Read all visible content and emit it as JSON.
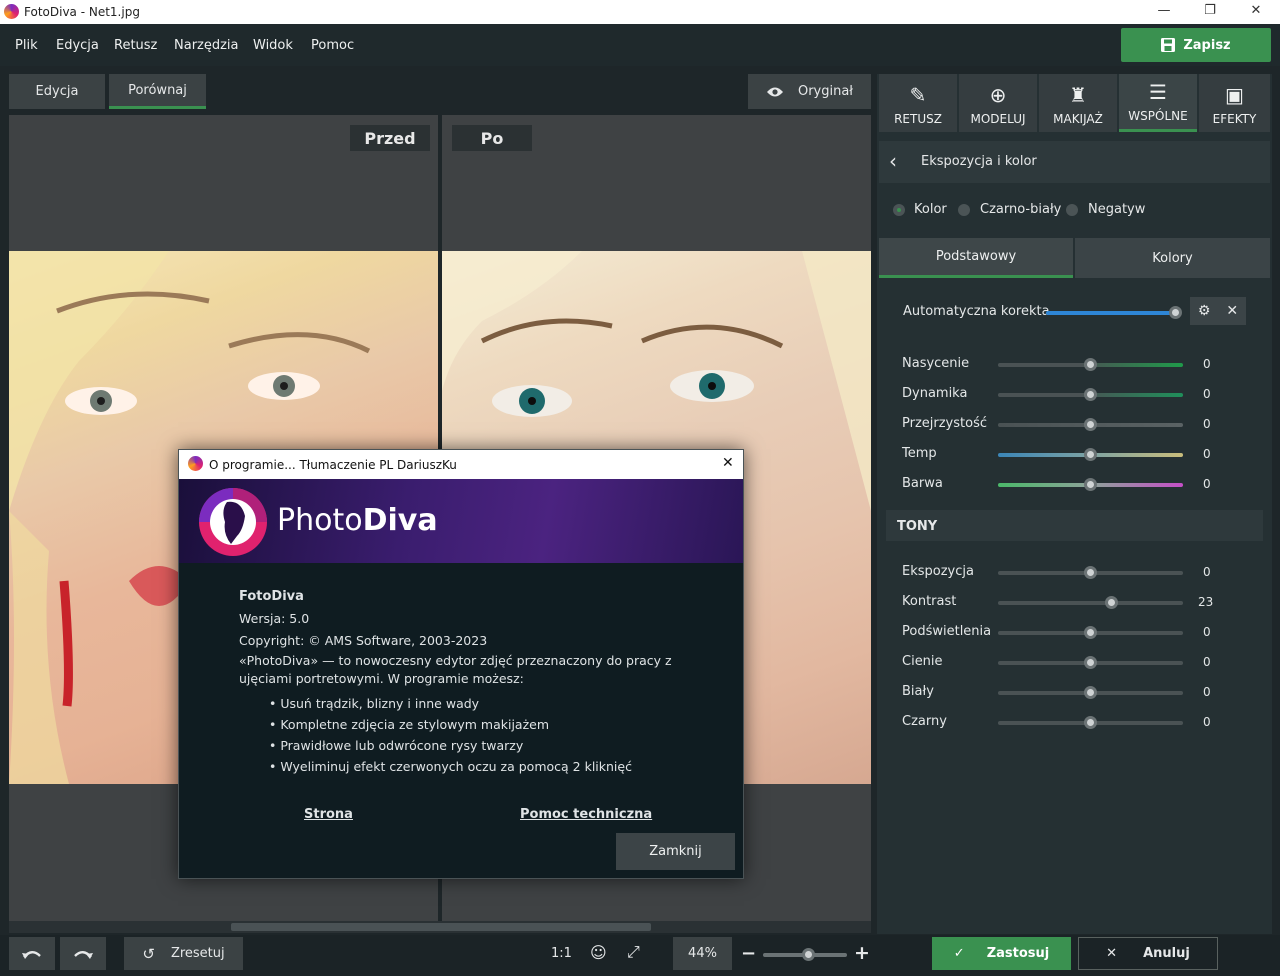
{
  "window": {
    "title": "FotoDiva - Net1.jpg",
    "minimize": "—",
    "maximize": "❐",
    "close": "✕"
  },
  "menu": [
    "Plik",
    "Edycja",
    "Retusz",
    "Narzędzia",
    "Widok",
    "Pomoc"
  ],
  "save_label": "Zapisz",
  "view_tabs": {
    "edit": "Edycja",
    "compare": "Porównaj",
    "original": "Oryginał"
  },
  "compare": {
    "before": "Przed",
    "after": "Po"
  },
  "tool_tabs": [
    "RETUSZ",
    "MODELUJ",
    "MAKIJAŻ",
    "WSPÓLNE",
    "EFEKTY"
  ],
  "section": {
    "title": "Ekspozycja i kolor"
  },
  "color_modes": {
    "options": [
      "Kolor",
      "Czarno-biały",
      "Negatyw"
    ],
    "selected": "Kolor"
  },
  "subtabs": {
    "basic": "Podstawowy",
    "colors": "Kolory"
  },
  "auto": {
    "label": "Automatyczna korekta",
    "value": 1.0
  },
  "color_sliders": [
    {
      "label": "Nasycenie",
      "value": "0",
      "level": 0.5
    },
    {
      "label": "Dynamika",
      "value": "0",
      "level": 0.5
    },
    {
      "label": "Przejrzystość",
      "value": "0",
      "level": 0.5
    },
    {
      "label": "Temp",
      "value": "0",
      "level": 0.5
    },
    {
      "label": "Barwa",
      "value": "0",
      "level": 0.5
    }
  ],
  "tony": {
    "title": "TONY"
  },
  "tone_sliders": [
    {
      "label": "Ekspozycja",
      "value": "0",
      "level": 0.5
    },
    {
      "label": "Kontrast",
      "value": "23",
      "level": 0.615
    },
    {
      "label": "Podświetlenia",
      "value": "0",
      "level": 0.5
    },
    {
      "label": "Cienie",
      "value": "0",
      "level": 0.5
    },
    {
      "label": "Biały",
      "value": "0",
      "level": 0.5
    },
    {
      "label": "Czarny",
      "value": "0",
      "level": 0.5
    }
  ],
  "bottom": {
    "reset": "Zresetuj",
    "one_to_one": "1:1",
    "zoom": "44%",
    "zoom_level": 0.55,
    "apply": "Zastosuj",
    "cancel": "Anuluj"
  },
  "dialog": {
    "title": "O programie... Tłumaczenie PL DariuszKu",
    "brand_a": "Photo",
    "brand_b": "Diva",
    "app_name": "FotoDiva",
    "version": "Wersja: 5.0",
    "copyright": "Copyright: © AMS Software, 2003-2023",
    "desc_1": "«PhotoDiva» — to nowoczesny edytor zdjęć przeznaczony do pracy z",
    "desc_2": "ujęciami portretowymi. W programie możesz:",
    "bullets": [
      "• Usuń trądzik, blizny i inne wady",
      "• Kompletne zdjęcia ze stylowym makijażem",
      "• Prawidłowe lub odwrócone rysy twarzy",
      "• Wyeliminuj efekt czerwonych oczu za pomocą 2 kliknięć"
    ],
    "link_site": "Strona",
    "link_support": "Pomoc techniczna",
    "close_button": "Zamknij"
  }
}
